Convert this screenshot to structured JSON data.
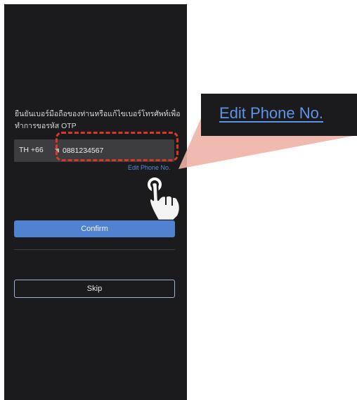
{
  "otp_screen": {
    "description": "ยืนยันเบอร์มือถือของท่านหรือแก้ไขเบอร์โทรศัพท์เพื่อทำการขอรหัส OTP",
    "country_code": "TH +66",
    "phone_value": "0881234567",
    "edit_phone_link": "Edit Phone No.",
    "confirm_label": "Confirm",
    "skip_label": "Skip"
  },
  "callout": {
    "label": "Edit Phone No."
  },
  "colors": {
    "screen_bg": "#1b1b1d",
    "field_bg": "#3d3d40",
    "accent_blue": "#4f82d1",
    "highlight_red": "#d8372a",
    "wedge_pink": "#f0b3a9"
  },
  "icons": {
    "dropdown": "caret-down-icon",
    "pointer": "tap-hand-icon"
  }
}
